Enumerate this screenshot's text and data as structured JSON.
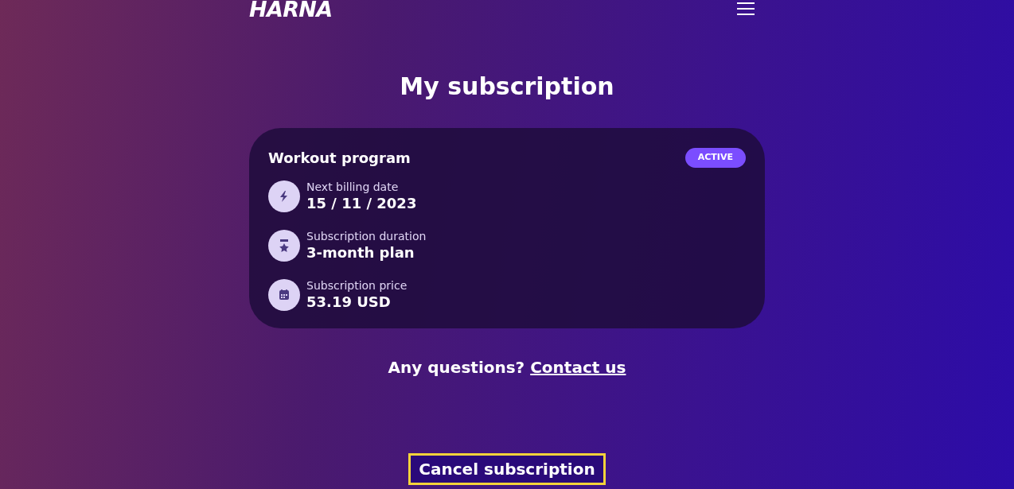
{
  "header": {
    "logo": "HARNA"
  },
  "title": "My subscription",
  "card": {
    "name": "Workout program",
    "status": "ACTIVE",
    "details": [
      {
        "kind": "bolt",
        "label": "Next billing date",
        "value": "15 / 11 / 2023"
      },
      {
        "kind": "medal",
        "label": "Subscription duration",
        "value": "3-month plan"
      },
      {
        "kind": "calendar",
        "label": "Subscription price",
        "value": "53.19 USD"
      }
    ]
  },
  "help": {
    "text": "Any questions?",
    "link": "Contact us"
  },
  "cancel_button": "Cancel subscription"
}
